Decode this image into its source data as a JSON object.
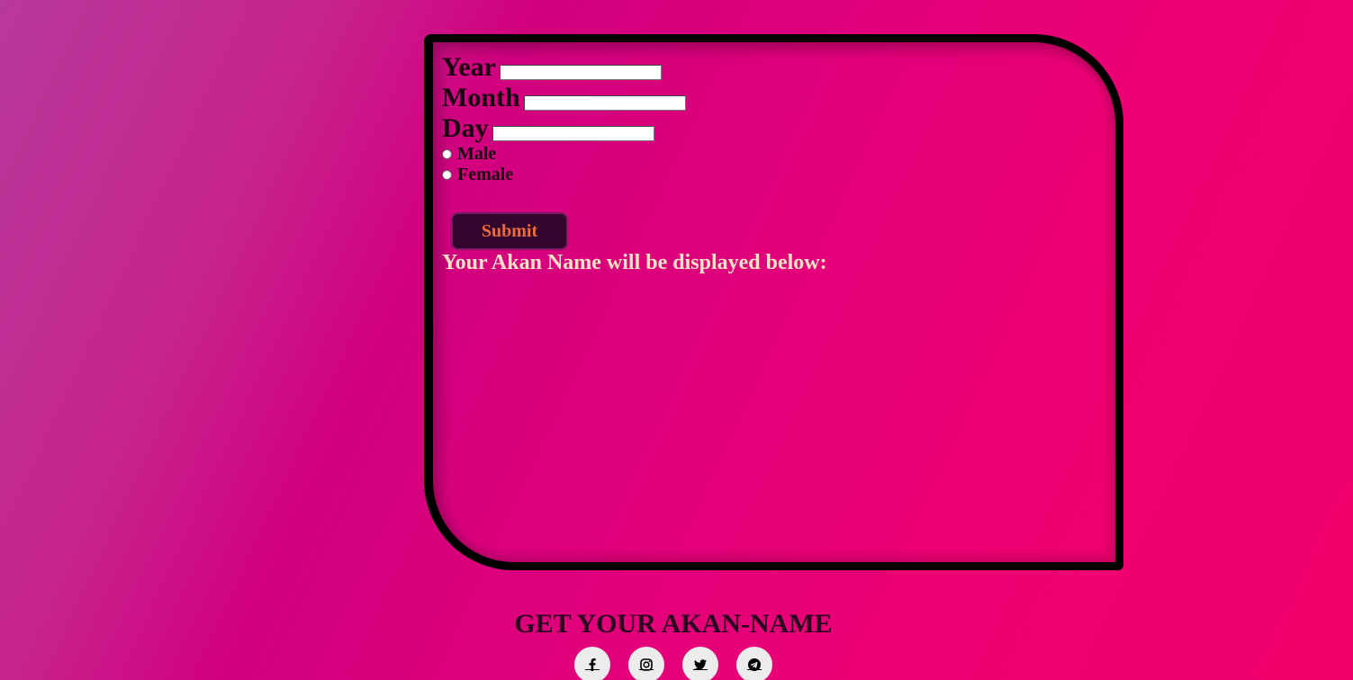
{
  "form": {
    "year_label": "Year",
    "year_value": "",
    "month_label": "Month",
    "month_value": "",
    "day_label": "Day",
    "day_value": "",
    "gender_options": [
      {
        "label": "Male",
        "checked": false
      },
      {
        "label": "Female",
        "checked": false
      }
    ],
    "submit_label": "Submit",
    "result_heading": "Your Akan Name will be displayed below:"
  },
  "footer": {
    "title": "GET YOUR AKAN-NAME",
    "social_icons": [
      "facebook-icon",
      "instagram-icon",
      "twitter-icon",
      "telegram-icon"
    ]
  },
  "colors": {
    "background_start": "#b8399a",
    "background_end": "#f1006a",
    "card_border": "#000000",
    "button_bg": "#32052d",
    "button_text": "#ef6b3d",
    "result_text": "#f6e3c4"
  }
}
